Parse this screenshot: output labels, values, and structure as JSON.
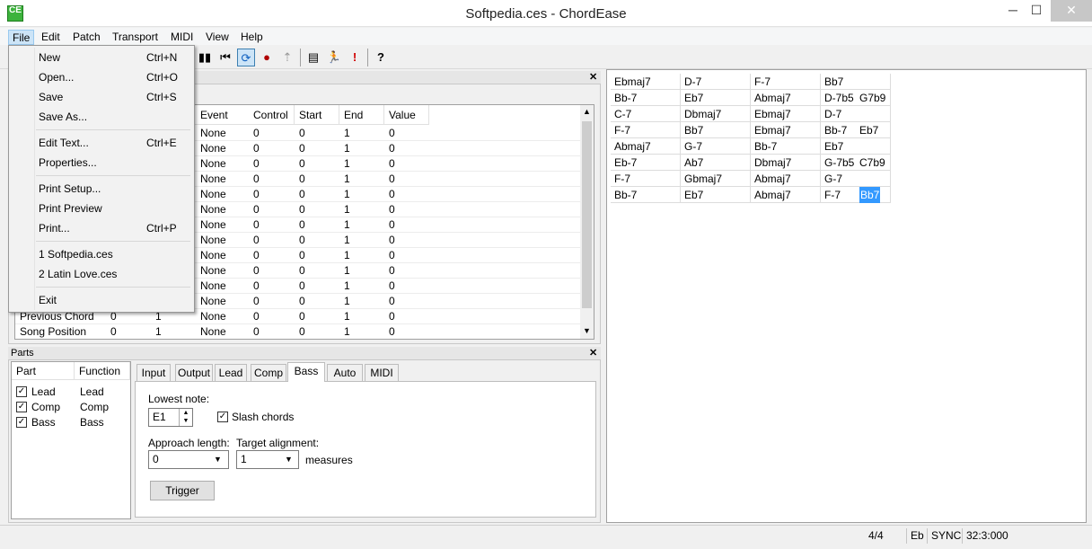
{
  "window": {
    "title": "Softpedia.ces - ChordEase",
    "minimize": "─",
    "maximize": "☐",
    "close": "✕"
  },
  "menubar": [
    "File",
    "Edit",
    "Patch",
    "Transport",
    "MIDI",
    "View",
    "Help"
  ],
  "file_menu": {
    "items": [
      {
        "label": "New",
        "shortcut": "Ctrl+N"
      },
      {
        "label": "Open...",
        "shortcut": "Ctrl+O"
      },
      {
        "label": "Save",
        "shortcut": "Ctrl+S"
      },
      {
        "label": "Save As...",
        "shortcut": ""
      },
      {
        "label": "Edit Text...",
        "shortcut": "Ctrl+E"
      },
      {
        "label": "Properties...",
        "shortcut": ""
      },
      {
        "label": "Print Setup...",
        "shortcut": ""
      },
      {
        "label": "Print Preview",
        "shortcut": ""
      },
      {
        "label": "Print...",
        "shortcut": "Ctrl+P"
      },
      {
        "label": "1 Softpedia.ces",
        "shortcut": ""
      },
      {
        "label": "2 Latin Love.ces",
        "shortcut": ""
      },
      {
        "label": "Exit",
        "shortcut": ""
      }
    ]
  },
  "toolbar": {
    "icons": [
      "pause-icon",
      "rewind-icon",
      "loop-icon",
      "record-icon",
      "bookmark-icon",
      "book-icon",
      "run-icon",
      "alert-icon",
      "help-icon"
    ]
  },
  "events": {
    "headers": [
      "Event",
      "Control",
      "Start",
      "End",
      "Value"
    ],
    "rows": [
      {
        "name": "",
        "a": "",
        "b": "",
        "event": "None",
        "control": "0",
        "start": "0",
        "end": "1",
        "value": "0"
      },
      {
        "name": "",
        "a": "",
        "b": "",
        "event": "None",
        "control": "0",
        "start": "0",
        "end": "1",
        "value": "0"
      },
      {
        "name": "",
        "a": "",
        "b": "",
        "event": "None",
        "control": "0",
        "start": "0",
        "end": "1",
        "value": "0"
      },
      {
        "name": "",
        "a": "",
        "b": "",
        "event": "None",
        "control": "0",
        "start": "0",
        "end": "1",
        "value": "0"
      },
      {
        "name": "",
        "a": "",
        "b": "",
        "event": "None",
        "control": "0",
        "start": "0",
        "end": "1",
        "value": "0"
      },
      {
        "name": "",
        "a": "",
        "b": "",
        "event": "None",
        "control": "0",
        "start": "0",
        "end": "1",
        "value": "0"
      },
      {
        "name": "",
        "a": "",
        "b": "",
        "event": "None",
        "control": "0",
        "start": "0",
        "end": "1",
        "value": "0"
      },
      {
        "name": "",
        "a": "",
        "b": "",
        "event": "None",
        "control": "0",
        "start": "0",
        "end": "1",
        "value": "0"
      },
      {
        "name": "",
        "a": "",
        "b": "",
        "event": "None",
        "control": "0",
        "start": "0",
        "end": "1",
        "value": "0"
      },
      {
        "name": "",
        "a": "",
        "b": "",
        "event": "None",
        "control": "0",
        "start": "0",
        "end": "1",
        "value": "0"
      },
      {
        "name": "",
        "a": "",
        "b": "",
        "event": "None",
        "control": "0",
        "start": "0",
        "end": "1",
        "value": "0"
      },
      {
        "name": "",
        "a": "",
        "b": "",
        "event": "None",
        "control": "0",
        "start": "0",
        "end": "1",
        "value": "0"
      },
      {
        "name": "Previous Chord",
        "a": "0",
        "b": "1",
        "event": "None",
        "control": "0",
        "start": "0",
        "end": "1",
        "value": "0"
      },
      {
        "name": "Song Position",
        "a": "0",
        "b": "1",
        "event": "None",
        "control": "0",
        "start": "0",
        "end": "1",
        "value": "0"
      }
    ]
  },
  "parts": {
    "title": "Parts",
    "headers": [
      "Part",
      "Function"
    ],
    "rows": [
      {
        "part": "Lead",
        "function": "Lead"
      },
      {
        "part": "Comp",
        "function": "Comp"
      },
      {
        "part": "Bass",
        "function": "Bass"
      }
    ],
    "tabs": [
      "Input",
      "Output",
      "Lead",
      "Comp",
      "Bass",
      "Auto",
      "MIDI"
    ],
    "active_tab": "Bass",
    "bass": {
      "lowest_note_label": "Lowest note:",
      "lowest_note": "E1",
      "slash_chords_label": "Slash chords",
      "approach_length_label": "Approach length:",
      "approach_length": "0",
      "target_alignment_label": "Target alignment:",
      "target_alignment": "1",
      "measures_label": "measures",
      "trigger_label": "Trigger"
    }
  },
  "chords": [
    [
      [
        "Ebmaj7"
      ],
      [
        "D-7"
      ],
      [
        "F-7"
      ],
      [
        "Bb7"
      ]
    ],
    [
      [
        "Bb-7"
      ],
      [
        "Eb7"
      ],
      [
        "Abmaj7"
      ],
      [
        "D-7b5",
        "G7b9"
      ]
    ],
    [
      [
        "C-7"
      ],
      [
        "Dbmaj7"
      ],
      [
        "Ebmaj7"
      ],
      [
        "D-7"
      ]
    ],
    [
      [
        "F-7"
      ],
      [
        "Bb7"
      ],
      [
        "Ebmaj7"
      ],
      [
        "Bb-7",
        "Eb7"
      ]
    ],
    [
      [
        "Abmaj7"
      ],
      [
        "G-7"
      ],
      [
        "Bb-7"
      ],
      [
        "Eb7"
      ]
    ],
    [
      [
        "Eb-7"
      ],
      [
        "Ab7"
      ],
      [
        "Dbmaj7"
      ],
      [
        "G-7b5",
        "C7b9"
      ]
    ],
    [
      [
        "F-7"
      ],
      [
        "Gbmaj7"
      ],
      [
        "Abmaj7"
      ],
      [
        "G-7"
      ]
    ],
    [
      [
        "Bb-7"
      ],
      [
        "Eb7"
      ],
      [
        "Abmaj7"
      ],
      [
        "F-7",
        "Bb7"
      ]
    ]
  ],
  "status": {
    "meter": "4/4",
    "key": "Eb",
    "sync": "SYNC",
    "position": "32:3:000"
  }
}
